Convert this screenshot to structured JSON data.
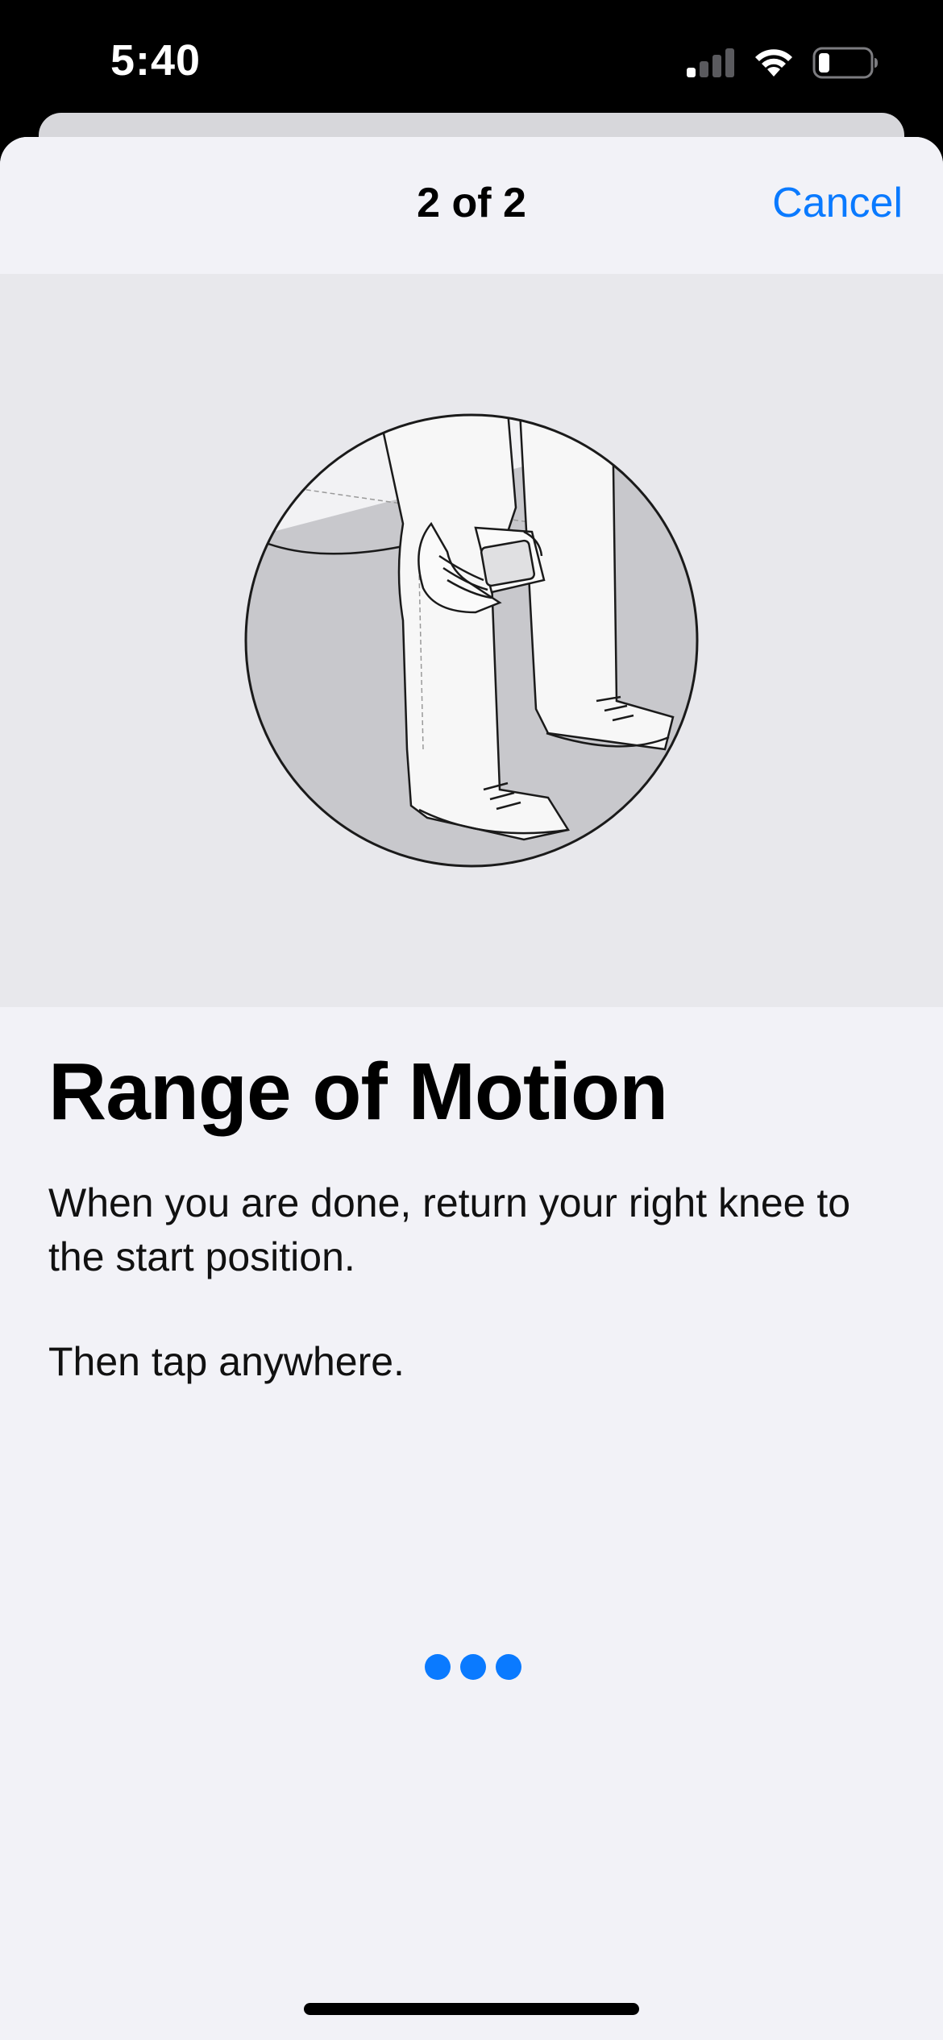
{
  "status_bar": {
    "time": "5:40",
    "icons": [
      "cellular-signal-icon",
      "wifi-icon",
      "battery-icon"
    ]
  },
  "nav": {
    "title": "2 of 2",
    "cancel_label": "Cancel"
  },
  "illustration": {
    "icon": "knee-range-of-motion-illustration"
  },
  "content": {
    "title": "Range of Motion",
    "instruction": "When you are done, return your right knee to the start position.",
    "instruction_2": "Then tap anywhere."
  },
  "activity_indicator": {
    "dot_count": 3
  },
  "colors": {
    "accent": "#0a7aff",
    "background": "#f2f2f7",
    "illustration_bg": "#e8e8ec"
  }
}
